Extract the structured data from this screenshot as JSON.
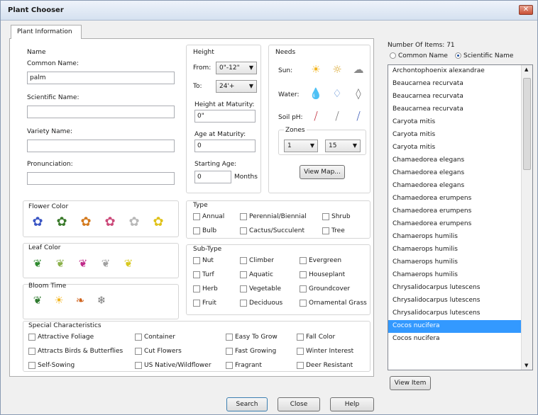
{
  "window": {
    "title": "Plant Chooser",
    "close": "✕"
  },
  "tab": "Plant Information",
  "name_section": {
    "header": "Name",
    "common_label": "Common Name:",
    "common_value": "palm",
    "scientific_label": "Scientific Name:",
    "scientific_value": "",
    "variety_label": "Variety Name:",
    "variety_value": "",
    "pronunciation_label": "Pronunciation:",
    "pronunciation_value": ""
  },
  "height_section": {
    "header": "Height",
    "from_label": "From:",
    "from_value": "0\"-12\"",
    "to_label": "To:",
    "to_value": "24'+",
    "maturity_height_label": "Height at Maturity:",
    "maturity_height_value": "0\"",
    "maturity_age_label": "Age at Maturity:",
    "maturity_age_value": "0",
    "starting_age_label": "Starting Age:",
    "starting_age_value": "0",
    "months_label": "Months"
  },
  "needs_section": {
    "header": "Needs",
    "sun_label": "Sun:",
    "water_label": "Water:",
    "soil_label": "Soil pH:",
    "zones_label": "Zones",
    "zone_from": "1",
    "zone_to": "15",
    "view_map": "View Map..."
  },
  "flower_color": {
    "header": "Flower Color",
    "colors": [
      "#3b56c4",
      "#3a7a2b",
      "#d47a1e",
      "#cc4a7a",
      "#b8b8b8",
      "#e0c21a"
    ]
  },
  "leaf_color": {
    "header": "Leaf Color",
    "colors": [
      "#2e8a2e",
      "#8ab04a",
      "#c02a8a",
      "#a0a0a0",
      "#d8c81e"
    ]
  },
  "bloom_time": {
    "header": "Bloom Time",
    "icons": [
      "spring-leaves-icon",
      "summer-sun-icon",
      "fall-leaf-icon",
      "winter-snowflake-icon"
    ]
  },
  "type_section": {
    "header": "Type",
    "items": [
      "Annual",
      "Perennial/Biennial",
      "Shrub",
      "Bulb",
      "Cactus/Succulent",
      "Tree"
    ]
  },
  "subtype_section": {
    "header": "Sub-Type",
    "items": [
      "Nut",
      "Climber",
      "Evergreen",
      "Turf",
      "Aquatic",
      "Houseplant",
      "Herb",
      "Vegetable",
      "Groundcover",
      "Fruit",
      "Deciduous",
      "Ornamental Grass"
    ]
  },
  "special_section": {
    "header": "Special Characteristics",
    "items": [
      "Attractive Foliage",
      "Container",
      "Easy To Grow",
      "Fall Color",
      "Attracts Birds & Butterflies",
      "Cut Flowers",
      "Fast Growing",
      "Winter Interest",
      "Self-Sowing",
      "US Native/Wildflower",
      "Fragrant",
      "Deer Resistant"
    ]
  },
  "results": {
    "count_label": "Number Of Items: 71",
    "radio_common": "Common Name",
    "radio_scientific": "Scientific Name",
    "items": [
      "Archontophoenix alexandrae",
      "Beaucarnea recurvata",
      "Beaucarnea recurvata",
      "Beaucarnea recurvata",
      "Caryota mitis",
      "Caryota mitis",
      "Caryota mitis",
      "Chamaedorea elegans",
      "Chamaedorea elegans",
      "Chamaedorea elegans",
      "Chamaedorea erumpens",
      "Chamaedorea erumpens",
      "Chamaedorea erumpens",
      "Chamaerops humilis",
      "Chamaerops humilis",
      "Chamaerops humilis",
      "Chamaerops humilis",
      "Chrysalidocarpus lutescens",
      "Chrysalidocarpus lutescens",
      "Chrysalidocarpus lutescens",
      "Cocos nucifera",
      "Cocos nucifera"
    ],
    "selected_index": 20,
    "view_item": "View Item"
  },
  "buttons": {
    "search": "Search",
    "close": "Close",
    "help": "Help"
  }
}
